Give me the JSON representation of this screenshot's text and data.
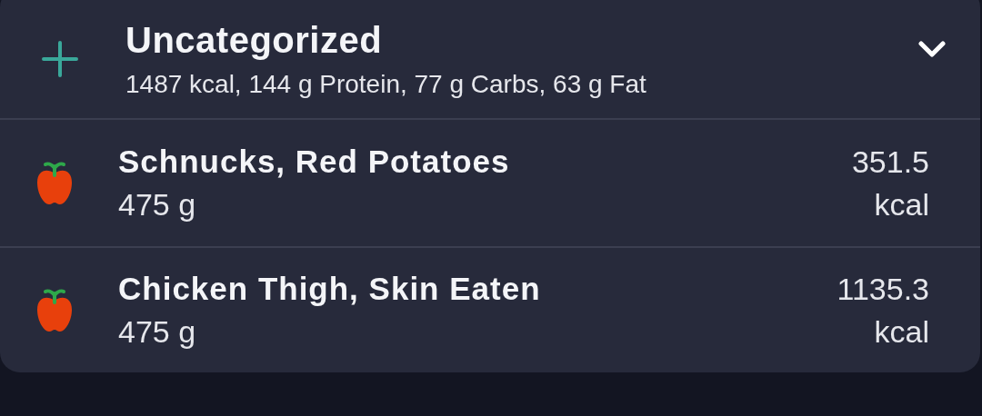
{
  "group": {
    "title": "Uncategorized",
    "summary": "1487 kcal, 144 g Protein, 77 g Carbs, 63 g Fat",
    "expanded": true
  },
  "items": [
    {
      "name": "Schnucks, Red Potatoes",
      "amount": "475 g",
      "energy": "351.5",
      "unit": "kcal"
    },
    {
      "name": "Chicken Thigh, Skin Eaten",
      "amount": "475 g",
      "energy": "1135.3",
      "unit": "kcal"
    }
  ]
}
